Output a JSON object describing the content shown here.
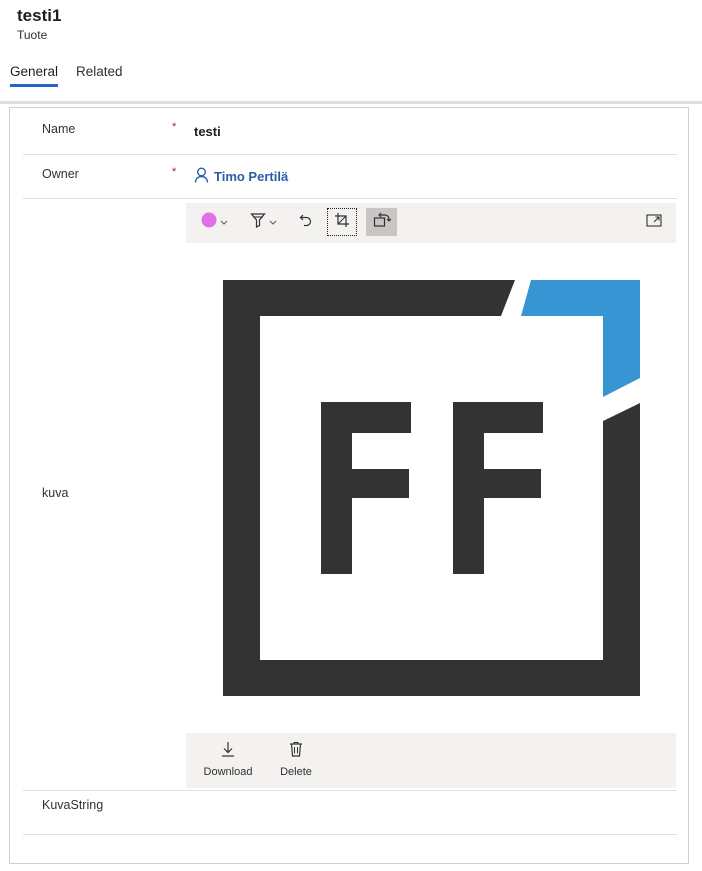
{
  "record": {
    "title": "testi1",
    "entity": "Tuote"
  },
  "tabs": [
    {
      "label": "General"
    },
    {
      "label": "Related"
    }
  ],
  "fields": {
    "name": {
      "label": "Name",
      "required": "*",
      "value": "testi"
    },
    "owner": {
      "label": "Owner",
      "required": "*",
      "value": "Timo Pertilä"
    },
    "image": {
      "label": "kuva"
    },
    "kuvastring": {
      "label": "KuvaString"
    }
  },
  "image_toolbar": {
    "icons": [
      "color-circle-icon",
      "chevron-down-icon",
      "filter-icon",
      "chevron-down-icon",
      "undo-icon",
      "crop-icon",
      "rotate-icon",
      "expand-icon"
    ],
    "pen_color": "#e36fe8"
  },
  "image_actions": {
    "download": "Download",
    "delete": "Delete"
  },
  "logo_colors": {
    "dark": "#333333",
    "accent": "#3895d3"
  }
}
